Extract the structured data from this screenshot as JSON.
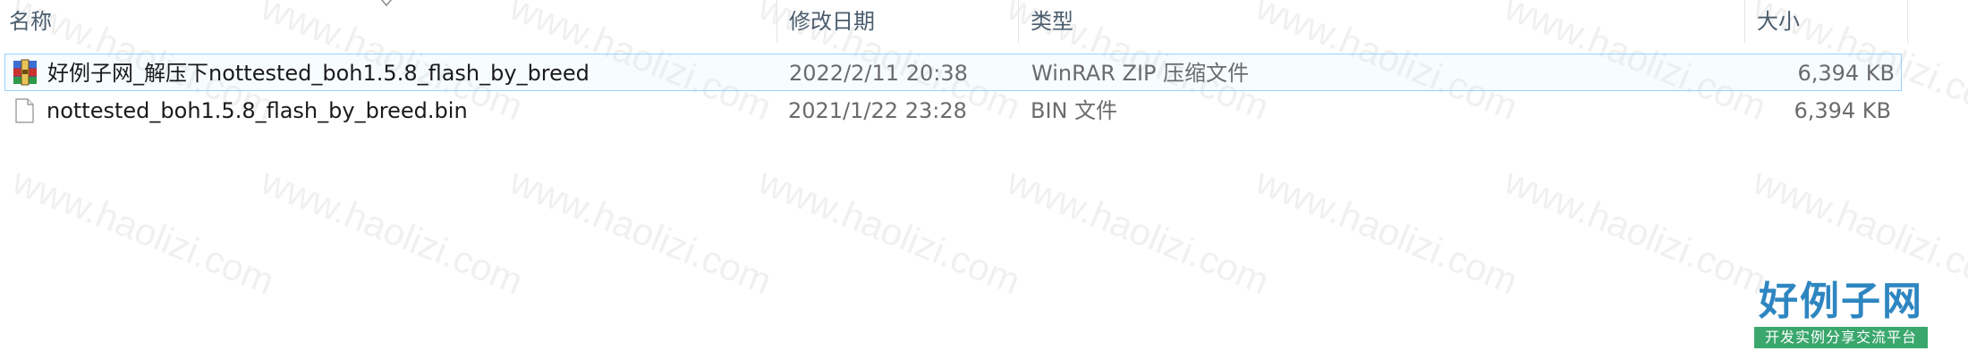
{
  "columns": {
    "name": "名称",
    "date": "修改日期",
    "type": "类型",
    "size": "大小"
  },
  "files": [
    {
      "name": "好例子网_解压下nottested_boh1.5.8_flash_by_breed",
      "date": "2022/2/11 20:38",
      "type": "WinRAR ZIP 压缩文件",
      "size": "6,394 KB",
      "icon": "winrar-archive-icon",
      "selected": true
    },
    {
      "name": "nottested_boh1.5.8_flash_by_breed.bin",
      "date": "2021/1/22 23:28",
      "type": "BIN 文件",
      "size": "6,394 KB",
      "icon": "blank-file-icon",
      "selected": false
    }
  ],
  "watermark": {
    "text": "www.haolizi.com"
  },
  "logo": {
    "title": "好例子网",
    "subtitle": "开发实例分享交流平台"
  },
  "colors": {
    "selection_border": "#99d1ff",
    "header_text": "#4b5d6d",
    "logo_blue": "#2e86c1",
    "logo_green": "#3aa76d"
  }
}
